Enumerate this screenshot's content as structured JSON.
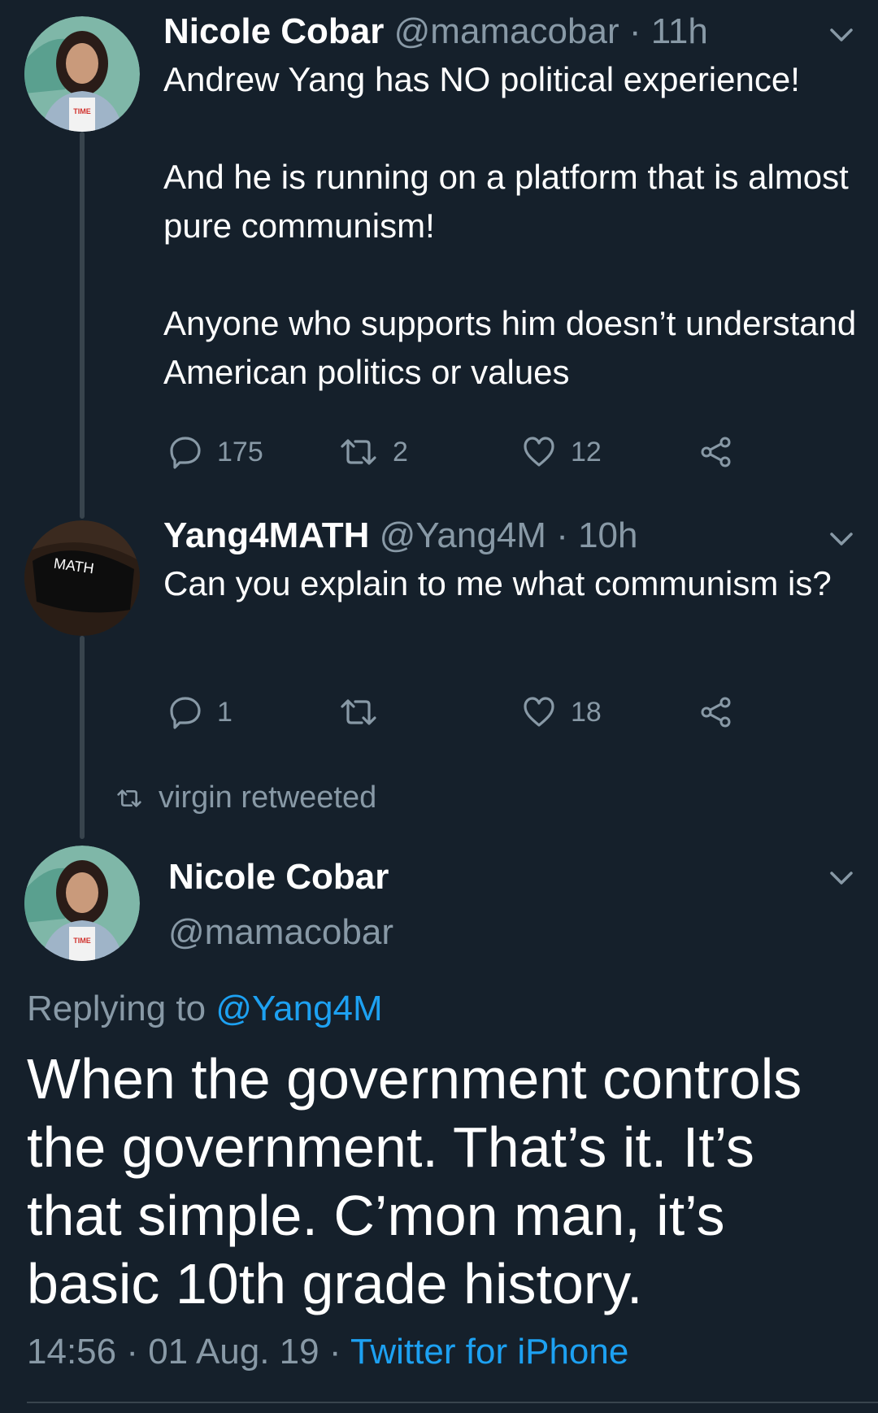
{
  "tweets": [
    {
      "name": "Nicole Cobar",
      "handle": "@mamacobar",
      "time": "· 11h",
      "paragraphs": [
        "Andrew Yang has NO political experience!",
        "And he is running on a platform that is almost pure communism!",
        "Anyone who supports him doesn’t understand American politics or values"
      ],
      "replies": "175",
      "retweets": "2",
      "likes": "12"
    },
    {
      "name": "Yang4MATH",
      "handle": "@Yang4M",
      "time": "· 10h",
      "paragraphs": [
        "Can you explain to me what communism is?"
      ],
      "replies": "1",
      "retweets": "",
      "likes": "18",
      "avatar_text": "MATH"
    }
  ],
  "retweet_banner": "virgin retweeted",
  "main_tweet": {
    "name": "Nicole Cobar",
    "handle": "@mamacobar",
    "replying_prefix": "Replying to",
    "replying_to": "@Yang4M",
    "text": "When the government controls the government. That’s it. It’s that simple. C’mon man, it’s basic 10th grade history.",
    "timestamp": "14:56 · 01 Aug. 19 ·",
    "source": "Twitter for iPhone"
  },
  "colors": {
    "background": "#15202b",
    "text": "#ffffff",
    "muted": "#8899a6",
    "link": "#1da1f2",
    "thread_line": "#38444d"
  },
  "icons": [
    "reply-icon",
    "retweet-icon",
    "like-icon",
    "share-icon",
    "caret-down-icon"
  ]
}
